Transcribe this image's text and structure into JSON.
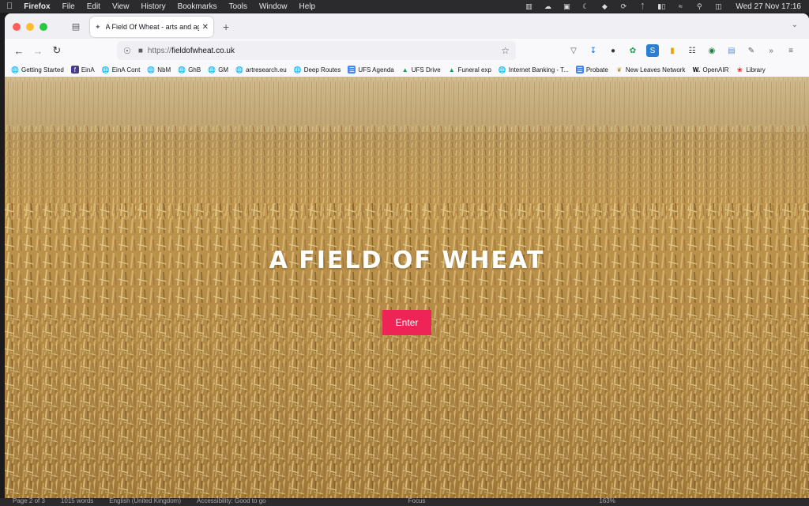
{
  "menubar": {
    "app": "Firefox",
    "menus": [
      "File",
      "Edit",
      "View",
      "History",
      "Bookmarks",
      "Tools",
      "Window",
      "Help"
    ],
    "clock": "Wed 27 Nov  17:16"
  },
  "tab": {
    "title": "A Field Of Wheat - arts and agri"
  },
  "urlbar": {
    "protocol": "https://",
    "host": "fieldofwheat.co.uk"
  },
  "bookmarks": [
    {
      "label": "Getting Started",
      "icon": "globe-icon"
    },
    {
      "label": "EinA",
      "icon": "eina-logo-icon"
    },
    {
      "label": "EinA Cont",
      "icon": "globe-icon"
    },
    {
      "label": "NbM",
      "icon": "globe-icon"
    },
    {
      "label": "GhB",
      "icon": "globe-icon"
    },
    {
      "label": "GM",
      "icon": "globe-icon"
    },
    {
      "label": "artresearch.eu",
      "icon": "globe-icon"
    },
    {
      "label": "Deep Routes",
      "icon": "globe-icon"
    },
    {
      "label": "UFS Agenda",
      "icon": "docs-icon"
    },
    {
      "label": "UFS Drive",
      "icon": "drive-icon"
    },
    {
      "label": "Funeral exp",
      "icon": "drive-icon"
    },
    {
      "label": "Internet Banking - T...",
      "icon": "globe-icon"
    },
    {
      "label": "Probate",
      "icon": "docs-icon"
    },
    {
      "label": "New Leaves Network",
      "icon": "leaf-icon"
    },
    {
      "label": "OpenAIR",
      "icon": "w-logo-icon"
    },
    {
      "label": "Library",
      "icon": "library-icon"
    }
  ],
  "hero": {
    "title": "A FIELD OF WHEAT",
    "button": "Enter"
  },
  "statusbar": {
    "page": "Page 2 of 3",
    "words": "1015 words",
    "language": "English (United Kingdom)",
    "accessibility": "Accessibility: Good to go",
    "focus": "Focus",
    "zoom": "163%"
  },
  "colors": {
    "accent": "#ee2356",
    "wheat": "#c8a45a"
  }
}
